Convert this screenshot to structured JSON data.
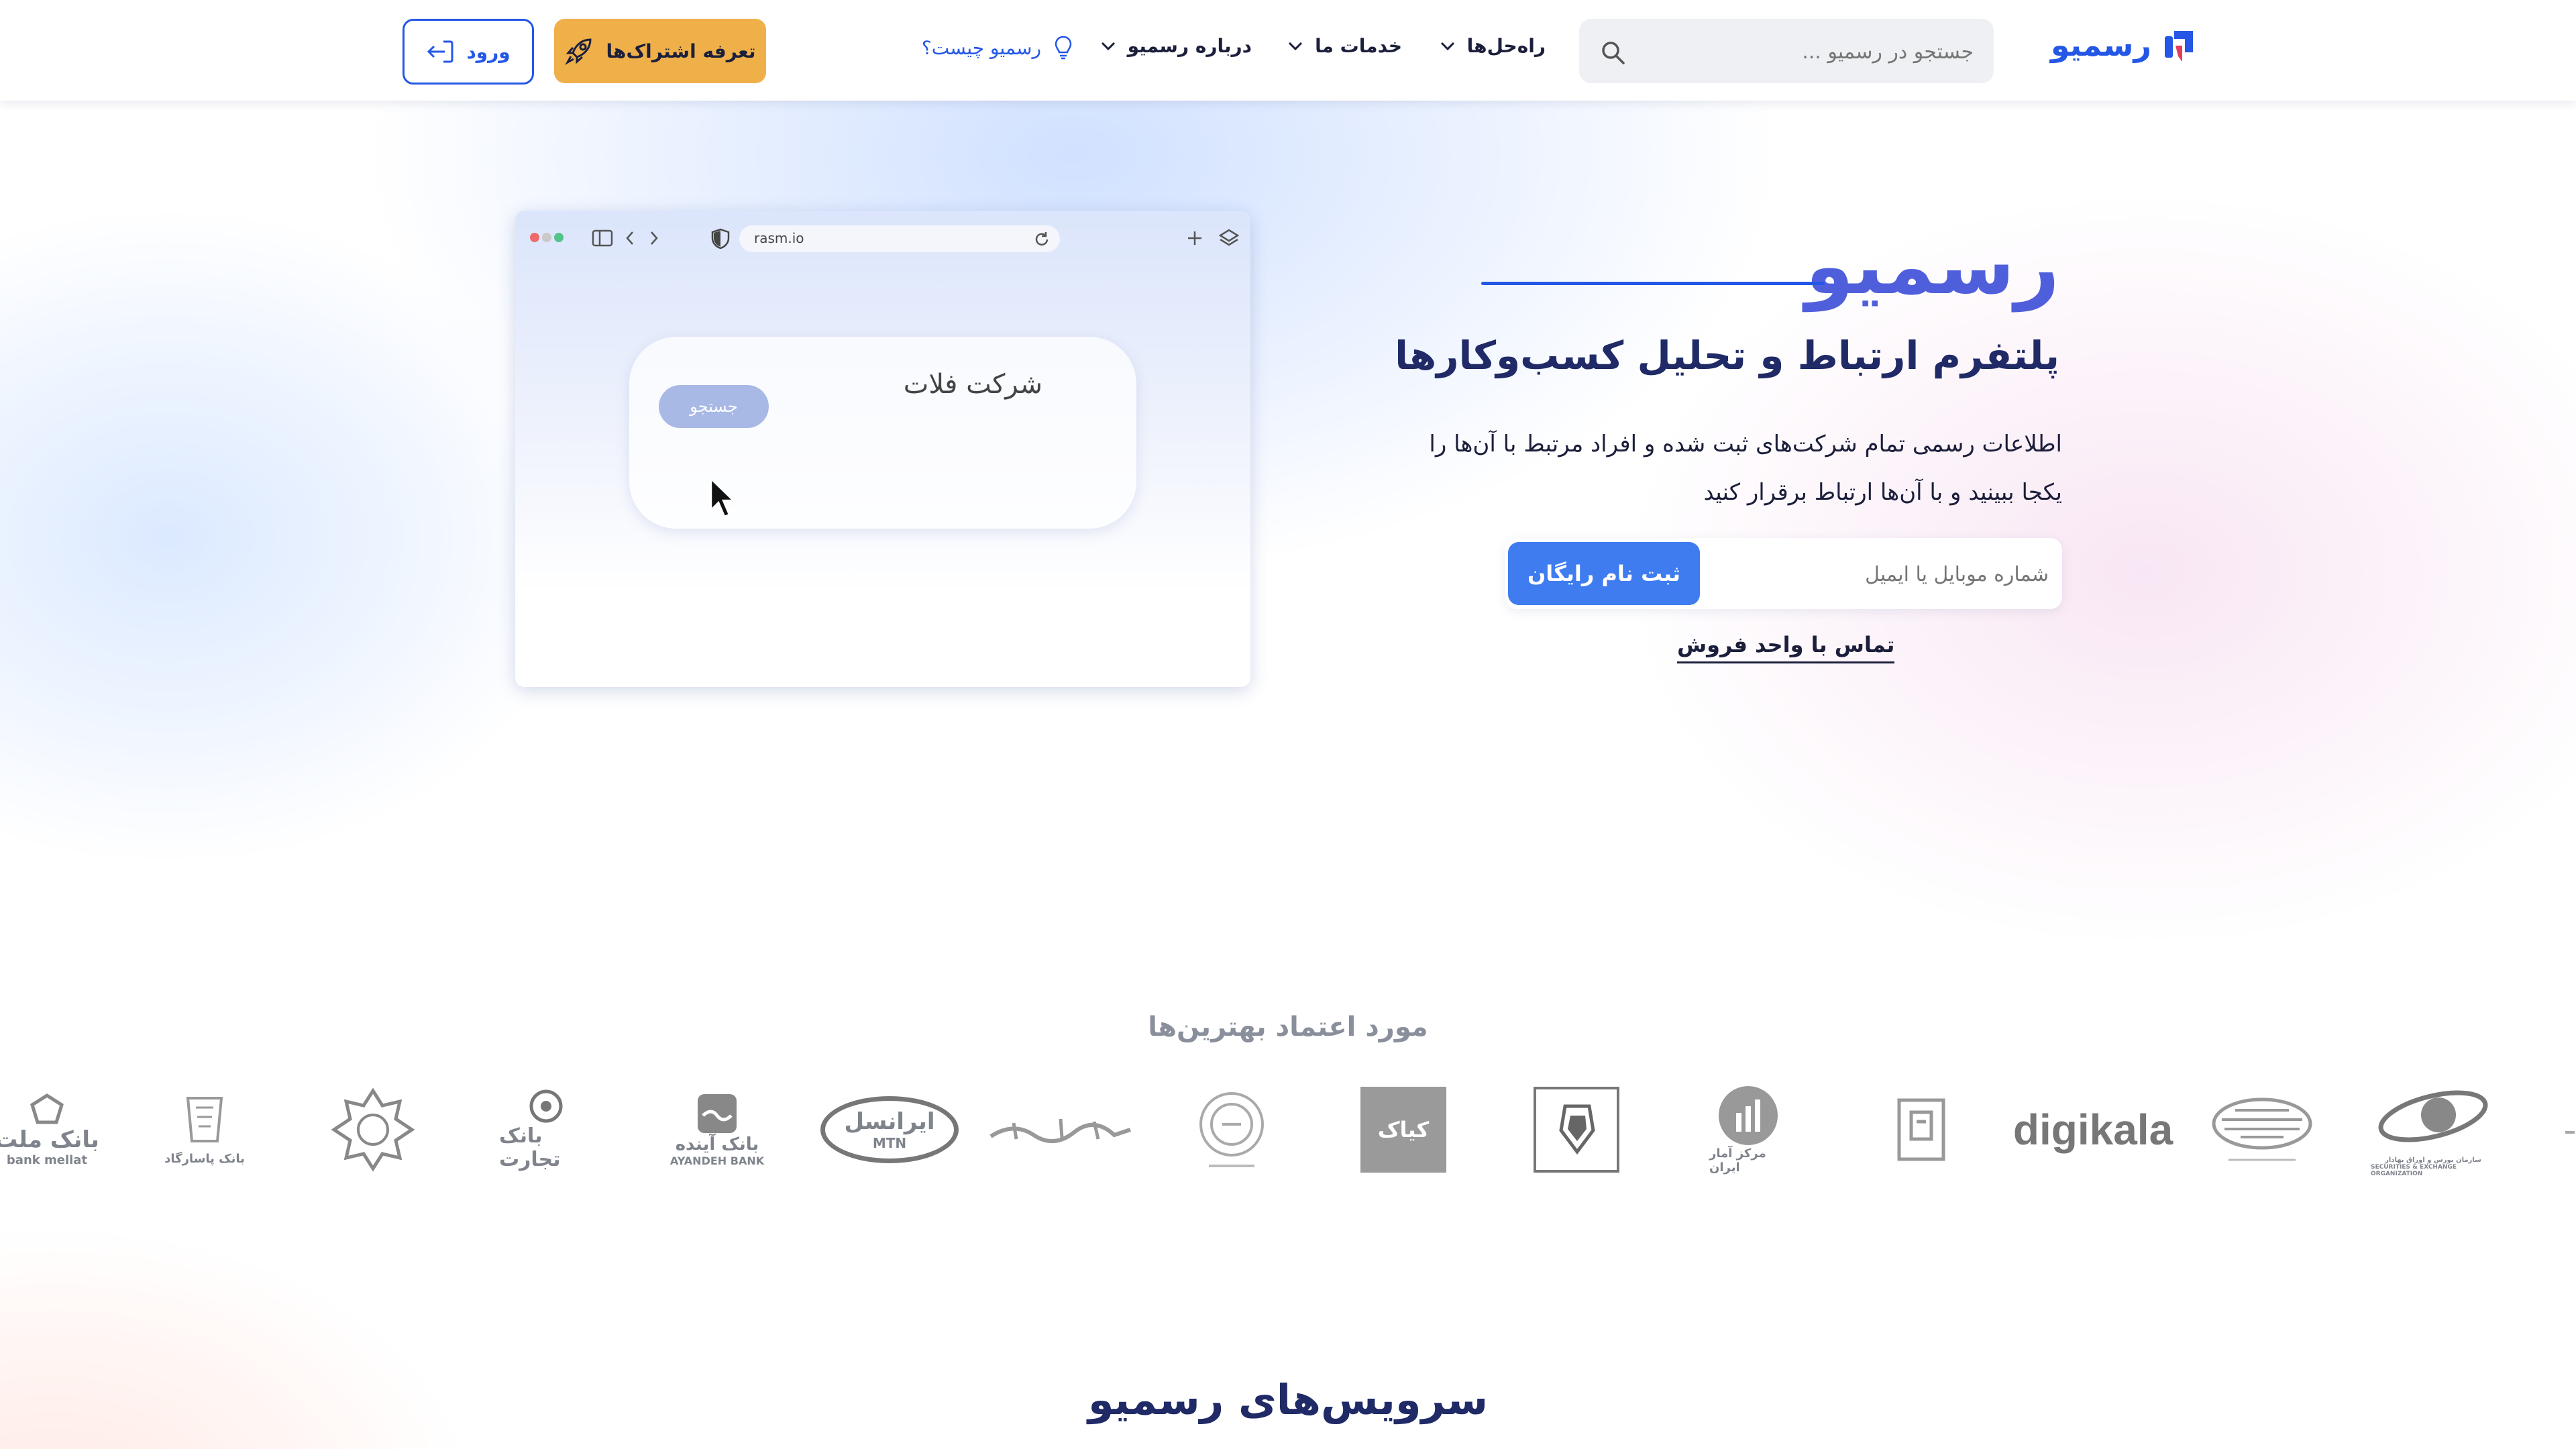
{
  "header": {
    "logo_text": "رسمیو",
    "search_placeholder": "جستجو در رسمیو ...",
    "nav": {
      "solutions": "راه‌حل‌ها",
      "services": "خدمات ما",
      "about": "درباره رسمیو",
      "what_is": "رسمیو چیست؟"
    },
    "subscription_button": "تعرفه اشتراک‌ها",
    "login_button": "ورود"
  },
  "browser_mockup": {
    "url": "rasm.io",
    "company_text": "شرکت فلات",
    "search_pill": "جستجو"
  },
  "hero": {
    "brand": "رسمیو",
    "title": "پلتفرم ارتباط و تحلیل کسب‌وکارها",
    "description": "اطلاعات رسمی تمام شرکت‌های ثبت شده و افراد مرتبط با آن‌ها را یکجا ببینید و با آن‌ها ارتباط برقرار کنید",
    "signup_placeholder": "شماره موبایل یا ایمیل",
    "signup_button": "ثبت نام رایگان",
    "sales_link": "تماس با واحد فروش"
  },
  "trusted": {
    "title": "مورد اعتماد بهترین‌ها",
    "logos": [
      {
        "name": "bank-mellat",
        "label": "بانک ملت",
        "sub": "bank mellat"
      },
      {
        "name": "bank-pasargad",
        "label": "بانک پاسارگاد",
        "sub": ""
      },
      {
        "name": "rosette-emblem",
        "label": "",
        "sub": ""
      },
      {
        "name": "bank-tejarat",
        "label": "بانک تجارت",
        "sub": ""
      },
      {
        "name": "ayandeh-bank",
        "label": "بانک آینده",
        "sub": "AYANDEH BANK"
      },
      {
        "name": "irancell",
        "label": "ایرانسل",
        "sub": "MTN"
      },
      {
        "name": "calligraphy-logo",
        "label": "",
        "sub": ""
      },
      {
        "name": "tejarat-emblem",
        "label": "",
        "sub": ""
      },
      {
        "name": "kayak",
        "label": "کیاک",
        "sub": ""
      },
      {
        "name": "irankhodro",
        "label": "",
        "sub": ""
      },
      {
        "name": "markaz-amar",
        "label": "مرکز آمار ایران",
        "sub": ""
      },
      {
        "name": "open-banking-hub",
        "label": "",
        "sub": ""
      },
      {
        "name": "digikala",
        "label": "digikala",
        "sub": ""
      },
      {
        "name": "shaparak",
        "label": "",
        "sub": ""
      },
      {
        "name": "securities-org",
        "label": "سازمان بورس و اوراق بهادار",
        "sub": "SECURITIES & EXCHANGE ORGANIZATION"
      }
    ]
  },
  "services_title": "سرویس‌های رسمیو",
  "colors": {
    "primary": "#2457e6",
    "accent": "#efb04a",
    "brand_purple": "#4f5fdc",
    "dark": "#1f2a66"
  }
}
